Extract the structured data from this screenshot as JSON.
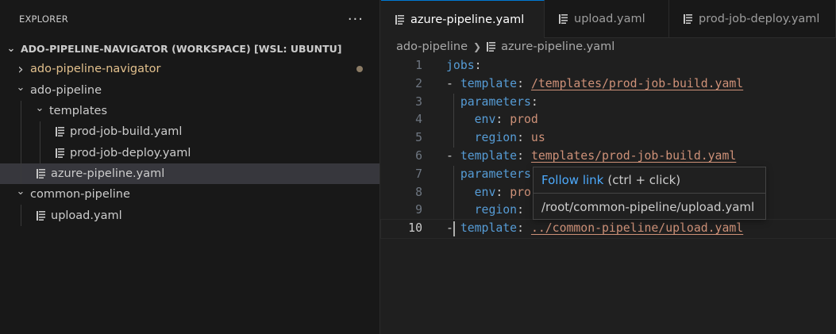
{
  "explorer": {
    "title": "EXPLORER",
    "more": "···",
    "workspace": "ADO-PIPELINE-NAVIGATOR (WORKSPACE) [WSL: UBUNTU]",
    "tree": [
      {
        "label": "ado-pipeline-navigator",
        "kind": "folder",
        "expanded": false,
        "modified": true
      },
      {
        "label": "ado-pipeline",
        "kind": "folder",
        "expanded": true
      },
      {
        "label": "templates",
        "kind": "folder",
        "expanded": true
      },
      {
        "label": "prod-job-build.yaml",
        "kind": "file"
      },
      {
        "label": "prod-job-deploy.yaml",
        "kind": "file"
      },
      {
        "label": "azure-pipeline.yaml",
        "kind": "file",
        "selected": true
      },
      {
        "label": "common-pipeline",
        "kind": "folder",
        "expanded": true
      },
      {
        "label": "upload.yaml",
        "kind": "file"
      }
    ]
  },
  "tabs": [
    {
      "label": "azure-pipeline.yaml",
      "active": true,
      "dirty": true
    },
    {
      "label": "upload.yaml"
    },
    {
      "label": "prod-job-deploy.yaml"
    }
  ],
  "breadcrumb": {
    "folder": "ado-pipeline",
    "file": "azure-pipeline.yaml"
  },
  "code": {
    "lines": [
      {
        "n": "1",
        "tokens": [
          {
            "t": "jobs",
            "c": "k"
          },
          {
            "t": ":",
            "c": "p"
          }
        ]
      },
      {
        "n": "2",
        "tokens": [
          {
            "t": "- ",
            "c": "p"
          },
          {
            "t": "template",
            "c": "k"
          },
          {
            "t": ": ",
            "c": "p"
          },
          {
            "t": "/templates/prod-job-build.yaml",
            "c": "link"
          }
        ]
      },
      {
        "n": "3",
        "tokens": [
          {
            "t": "  ",
            "c": "p"
          },
          {
            "t": "parameters",
            "c": "k"
          },
          {
            "t": ":",
            "c": "p"
          }
        ]
      },
      {
        "n": "4",
        "tokens": [
          {
            "t": "    ",
            "c": "p"
          },
          {
            "t": "env",
            "c": "k"
          },
          {
            "t": ": ",
            "c": "p"
          },
          {
            "t": "prod",
            "c": "s"
          }
        ]
      },
      {
        "n": "5",
        "tokens": [
          {
            "t": "    ",
            "c": "p"
          },
          {
            "t": "region",
            "c": "k"
          },
          {
            "t": ": ",
            "c": "p"
          },
          {
            "t": "us",
            "c": "s"
          }
        ]
      },
      {
        "n": "6",
        "tokens": [
          {
            "t": "- ",
            "c": "p"
          },
          {
            "t": "template",
            "c": "k"
          },
          {
            "t": ": ",
            "c": "p"
          },
          {
            "t": "templates/prod-job-build.yaml",
            "c": "link"
          }
        ]
      },
      {
        "n": "7",
        "tokens": [
          {
            "t": "  ",
            "c": "p"
          },
          {
            "t": "parameters",
            "c": "k"
          }
        ]
      },
      {
        "n": "8",
        "tokens": [
          {
            "t": "    ",
            "c": "p"
          },
          {
            "t": "env",
            "c": "k"
          },
          {
            "t": ": ",
            "c": "p"
          },
          {
            "t": "pro",
            "c": "s"
          }
        ]
      },
      {
        "n": "9",
        "tokens": [
          {
            "t": "    ",
            "c": "p"
          },
          {
            "t": "region",
            "c": "k"
          },
          {
            "t": ":",
            "c": "p"
          }
        ]
      },
      {
        "n": "10",
        "current": true,
        "tokens": [
          {
            "t": "- ",
            "c": "p"
          },
          {
            "t": "template",
            "c": "k"
          },
          {
            "t": ": ",
            "c": "p"
          },
          {
            "t": "../common-pipeline/upload.yaml",
            "c": "link"
          }
        ]
      }
    ]
  },
  "hover": {
    "follow_link": "Follow link",
    "shortcut": "(ctrl + click)",
    "target": "/root/common-pipeline/upload.yaml"
  },
  "colors": {
    "accent": "#0078d4",
    "keyword": "#569cd6",
    "string": "#ce9178",
    "link_text": "#4daafc",
    "modified": "#e2c08d"
  },
  "icons": {
    "folder_closed": "chevron-right-icon",
    "folder_open": "chevron-down-icon",
    "file": "lines-file-icon",
    "more": "ellipsis-icon",
    "dirty": "dot-icon"
  }
}
